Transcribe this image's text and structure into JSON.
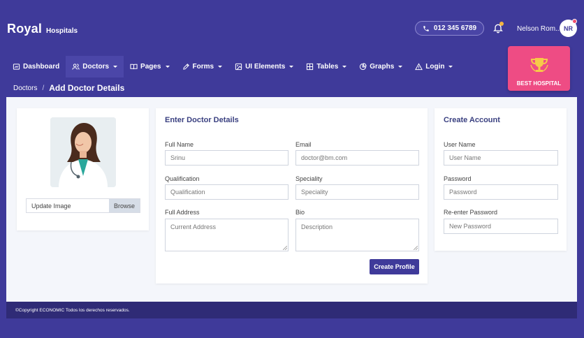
{
  "brand": {
    "name": "Royal",
    "sub": "Hospitals"
  },
  "header": {
    "phone": "012 345 6789",
    "user_name": "Nelson Rom...",
    "user_initials": "NR"
  },
  "nav": [
    {
      "label": "Dashboard",
      "icon": "dashboard-icon"
    },
    {
      "label": "Doctors",
      "icon": "users-icon",
      "active": true
    },
    {
      "label": "Pages",
      "icon": "book-icon"
    },
    {
      "label": "Forms",
      "icon": "pencil-icon"
    },
    {
      "label": "UI Elements",
      "icon": "image-icon"
    },
    {
      "label": "Tables",
      "icon": "grid-icon"
    },
    {
      "label": "Graphs",
      "icon": "pie-chart-icon"
    },
    {
      "label": "Login",
      "icon": "warning-icon"
    }
  ],
  "award": {
    "label": "BEST HOSPITAL"
  },
  "breadcrumb": {
    "parent": "Doctors",
    "separator": "/",
    "current": "Add Doctor Details"
  },
  "photo_card": {
    "upload_placeholder": "Update Image",
    "browse_label": "Browse"
  },
  "details": {
    "title": "Enter Doctor Details",
    "full_name_label": "Full Name",
    "full_name_value": "Srinu",
    "email_label": "Email",
    "email_value": "doctor@bm.com",
    "qualification_label": "Qualification",
    "qualification_placeholder": "Qualification",
    "speciality_label": "Speciality",
    "speciality_placeholder": "Speciality",
    "address_label": "Full Address",
    "address_placeholder": "Current Address",
    "bio_label": "Bio",
    "bio_placeholder": "Description",
    "submit_label": "Create Profile"
  },
  "account": {
    "title": "Create Account",
    "username_label": "User Name",
    "username_placeholder": "User Name",
    "password_label": "Password",
    "password_placeholder": "Password",
    "repassword_label": "Re-enter Password",
    "repassword_placeholder": "New Password"
  },
  "footer": {
    "text": "©Copyright ECONOMIC Todos los derechos reservados."
  },
  "colors": {
    "primary": "#3f3a9a",
    "award": "#ee4c84",
    "footer": "#2f2b76",
    "content_bg": "#f4f6fb"
  }
}
